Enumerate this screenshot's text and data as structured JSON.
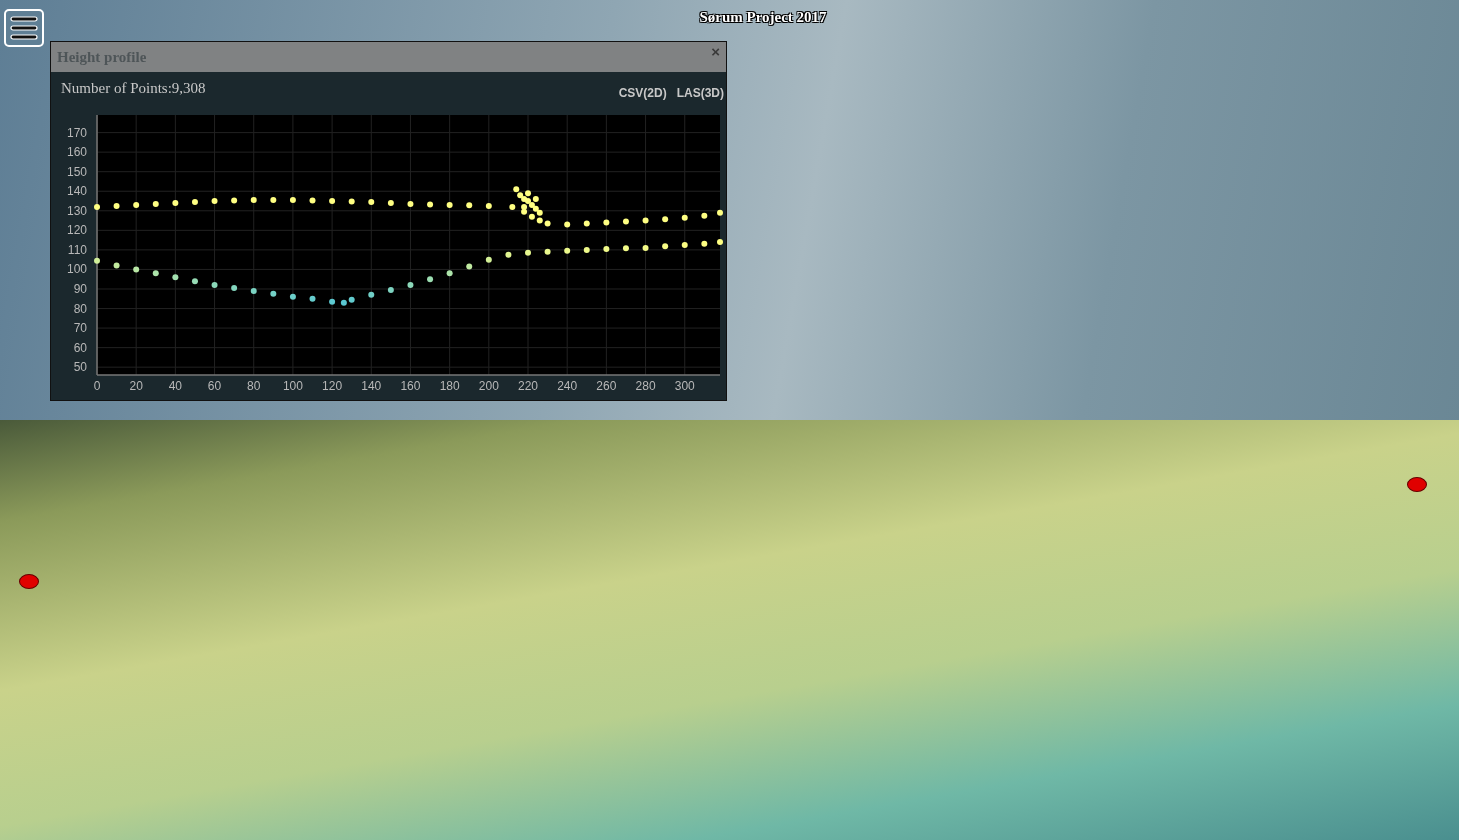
{
  "title": "Sørum Project 2017",
  "height_profile": {
    "title": "Height profile",
    "close": "×",
    "points_label": "Number of Points:9,308",
    "buttons": [
      "CSV(2D)",
      "LAS(3D)"
    ],
    "chart_data": {
      "type": "scatter",
      "x": [
        0,
        10,
        20,
        30,
        40,
        50,
        60,
        70,
        80,
        90,
        100,
        110,
        120,
        130,
        140,
        150,
        160,
        170,
        180,
        190,
        200,
        212,
        218,
        222,
        226,
        230,
        240,
        250,
        260,
        270,
        280,
        290,
        300,
        310,
        318,
        0,
        10,
        20,
        30,
        40,
        50,
        60,
        70,
        80,
        90,
        100,
        110,
        120,
        126,
        130,
        140,
        150,
        160,
        170,
        180,
        190,
        200,
        210,
        220,
        230,
        240,
        250,
        260,
        270,
        280,
        290,
        300,
        310,
        318,
        214,
        216,
        218,
        220,
        222,
        224,
        226,
        218,
        220,
        224
      ],
      "values": [
        132,
        132.5,
        133,
        133.5,
        134,
        134.5,
        135,
        135.3,
        135.5,
        135.5,
        135.5,
        135.2,
        135,
        134.8,
        134.5,
        134,
        133.5,
        133.2,
        133,
        132.8,
        132.5,
        132,
        129.5,
        127,
        125,
        123.5,
        123,
        123.5,
        124,
        124.5,
        125,
        125.7,
        126.5,
        127.5,
        129,
        104.5,
        102,
        100,
        98,
        96,
        94,
        92,
        90.5,
        89,
        87.5,
        86,
        85,
        83.5,
        83,
        84.5,
        87,
        89.5,
        92,
        95,
        98,
        101.5,
        105,
        107.5,
        108.5,
        109,
        109.5,
        110,
        110.5,
        110.8,
        111,
        111.8,
        112.5,
        113.2,
        114,
        141,
        138,
        136,
        139,
        133,
        131,
        129,
        132,
        135,
        136
      ],
      "xlim": [
        0,
        318
      ],
      "ylim": [
        46,
        179
      ],
      "grid": true,
      "xticks": [
        0,
        20,
        40,
        60,
        80,
        100,
        120,
        140,
        160,
        180,
        200,
        220,
        240,
        260,
        280,
        300
      ],
      "yticks": [
        50,
        60,
        70,
        80,
        90,
        100,
        110,
        120,
        130,
        140,
        150,
        160,
        170
      ]
    }
  }
}
